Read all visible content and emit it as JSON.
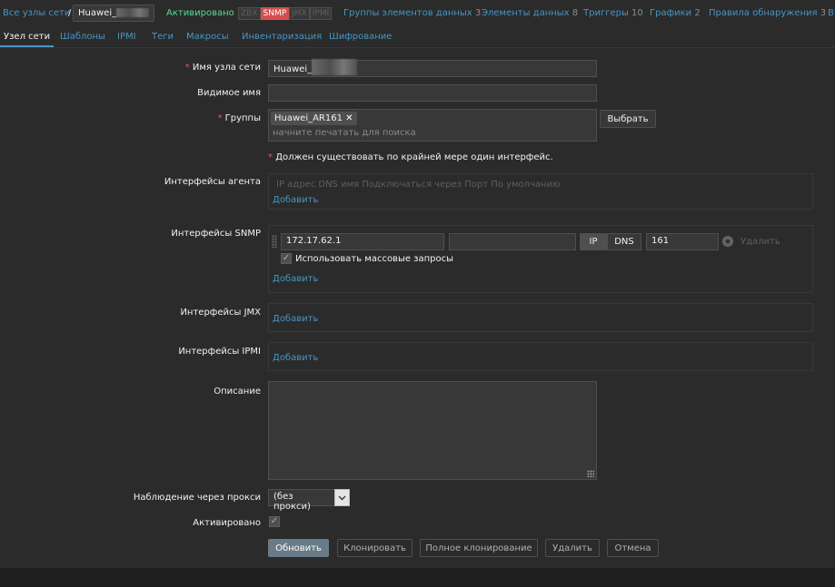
{
  "breadcrumb": {
    "all_hosts": "Все узлы сети",
    "separator": "/",
    "host_prefix": "Huawei_"
  },
  "status": "Активировано",
  "availability": [
    "ZBX",
    "SNMP",
    "JMX",
    "IPMI"
  ],
  "nav_links": [
    {
      "label": "Группы элементов данных",
      "count": "3"
    },
    {
      "label": "Элементы данных",
      "count": "8"
    },
    {
      "label": "Триггеры",
      "count": "10"
    },
    {
      "label": "Графики",
      "count": "2"
    },
    {
      "label": "Правила обнаружения",
      "count": "3"
    },
    {
      "label": "В",
      "count": ""
    }
  ],
  "tabs": [
    "Узел сети",
    "Шаблоны",
    "IPMI",
    "Теги",
    "Макросы",
    "Инвентаризация",
    "Шифрование"
  ],
  "form": {
    "host_name_label": "Имя узла сети",
    "host_name_value": "Huawei_",
    "visible_name_label": "Видимое имя",
    "visible_name_value": "",
    "groups_label": "Группы",
    "group_chip": "Huawei_AR161",
    "groups_placeholder": "начните печатать для поиска",
    "select_button": "Выбрать",
    "interface_warning": "Должен существовать по крайней мере один интерфейс.",
    "agent_interfaces_label": "Интерфейсы агента",
    "agent_headers": "IP адрес DNS имя Подключаться через Порт По умолчанию",
    "add_link": "Добавить",
    "snmp_interfaces_label": "Интерфейсы SNMP",
    "snmp_ip": "172.17.62.1",
    "snmp_dns": "",
    "snmp_connect_ip": "IP",
    "snmp_connect_dns": "DNS",
    "snmp_port": "161",
    "snmp_remove": "Удалить",
    "bulk_requests_label": "Использовать массовые запросы",
    "jmx_interfaces_label": "Интерфейсы JMX",
    "ipmi_interfaces_label": "Интерфейсы IPMI",
    "description_label": "Описание",
    "description_value": "",
    "proxy_label": "Наблюдение через прокси",
    "proxy_value": "(без прокси)",
    "enabled_label": "Активировано"
  },
  "buttons": {
    "update": "Обновить",
    "clone": "Клонировать",
    "full_clone": "Полное клонирование",
    "delete": "Удалить",
    "cancel": "Отмена"
  },
  "colors": {
    "background": "#2b2b2b",
    "link": "#4796c4",
    "status_green": "#59db8f",
    "snmp_red": "#d64e4e",
    "required_red": "#e45959"
  }
}
